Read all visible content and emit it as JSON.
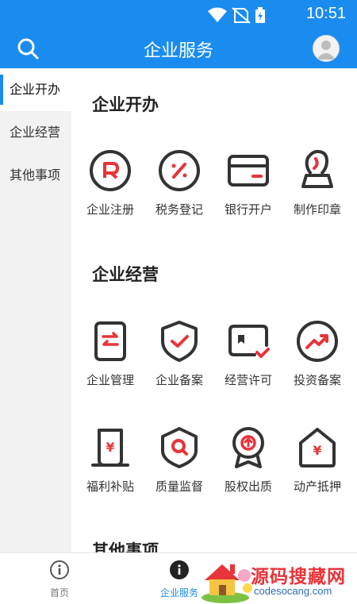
{
  "status": {
    "time": "10:51"
  },
  "appbar": {
    "title": "企业服务"
  },
  "sidebar": {
    "items": [
      {
        "label": "企业开办",
        "active": true
      },
      {
        "label": "企业经营",
        "active": false
      },
      {
        "label": "其他事项",
        "active": false
      }
    ]
  },
  "sections": [
    {
      "title": "企业开办",
      "items": [
        {
          "label": "企业注册",
          "icon": "registration-icon"
        },
        {
          "label": "税务登记",
          "icon": "tax-percent-icon"
        },
        {
          "label": "银行开户",
          "icon": "bank-card-icon"
        },
        {
          "label": "制作印章",
          "icon": "seal-icon"
        }
      ]
    },
    {
      "title": "企业经营",
      "items": [
        {
          "label": "企业管理",
          "icon": "manage-doc-icon"
        },
        {
          "label": "企业备案",
          "icon": "shield-check-icon"
        },
        {
          "label": "经营许可",
          "icon": "license-card-icon"
        },
        {
          "label": "投资备案",
          "icon": "investment-trend-icon"
        },
        {
          "label": "福利补贴",
          "icon": "subsidy-yuan-icon"
        },
        {
          "label": "质量监督",
          "icon": "quality-search-icon"
        },
        {
          "label": "股权出质",
          "icon": "equity-medal-icon"
        },
        {
          "label": "动产抵押",
          "icon": "mortgage-house-icon"
        }
      ]
    },
    {
      "title": "其他事项",
      "items": []
    }
  ],
  "bottom": {
    "tabs": [
      {
        "label": "首页",
        "active": false
      },
      {
        "label": "企业服务",
        "active": true
      }
    ]
  },
  "watermark": {
    "brand": "源码搜藏网",
    "url": "codesocang.com"
  },
  "colors": {
    "primary": "#1a8cf0",
    "accent": "#e8343a",
    "icon_dark": "#333333"
  }
}
